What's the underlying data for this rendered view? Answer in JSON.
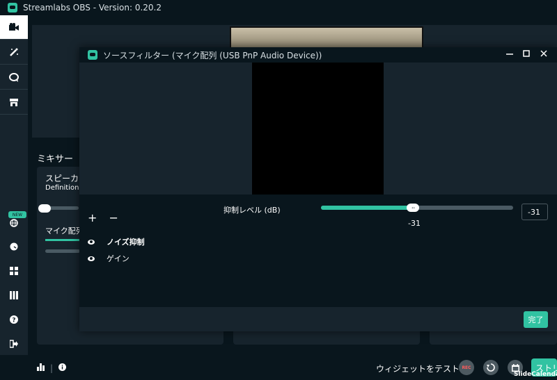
{
  "app": {
    "title": "Streamlabs OBS - Version: 0.20.2"
  },
  "sidebar": {
    "items": [
      {
        "name": "studio",
        "icon": "camera-icon",
        "active": true
      },
      {
        "name": "editor",
        "icon": "wand-icon"
      },
      {
        "name": "dashboard",
        "icon": "chat-icon"
      },
      {
        "name": "store",
        "icon": "store-icon"
      },
      {
        "name": "new-feature",
        "icon": "globe-icon",
        "badge": "NEW"
      },
      {
        "name": "themes",
        "icon": "dial-icon"
      },
      {
        "name": "layout",
        "icon": "grid-icon"
      },
      {
        "name": "columns",
        "icon": "columns-icon"
      },
      {
        "name": "help",
        "icon": "help-icon"
      },
      {
        "name": "logout",
        "icon": "logout-icon"
      },
      {
        "name": "settings",
        "icon": "gear-icon"
      }
    ]
  },
  "mixer": {
    "title": "ミキサー",
    "sources": [
      {
        "name": "スピーカー",
        "device": "Definition A"
      },
      {
        "name": "マイク配列"
      }
    ]
  },
  "bottombar": {
    "test_widgets": "ウィジェットをテスト",
    "rec_label": "REC",
    "go_live": "ストリ",
    "watermark": "SlideCalenda"
  },
  "modal": {
    "title": "ソースフィルター (マイク配列 (USB PnP Audio Device))",
    "add_label": "+",
    "remove_label": "−",
    "filters": [
      {
        "name": "ノイズ抑制",
        "visible": true,
        "selected": true
      },
      {
        "name": "ゲイン",
        "visible": true,
        "selected": false
      }
    ],
    "property": {
      "label": "抑制レベル (dB)",
      "value": "-31",
      "level_fraction": 0.48
    },
    "done_label": "完了"
  },
  "colors": {
    "accent": "#31c3a2",
    "background": "#09161d",
    "panel": "#17242d"
  }
}
